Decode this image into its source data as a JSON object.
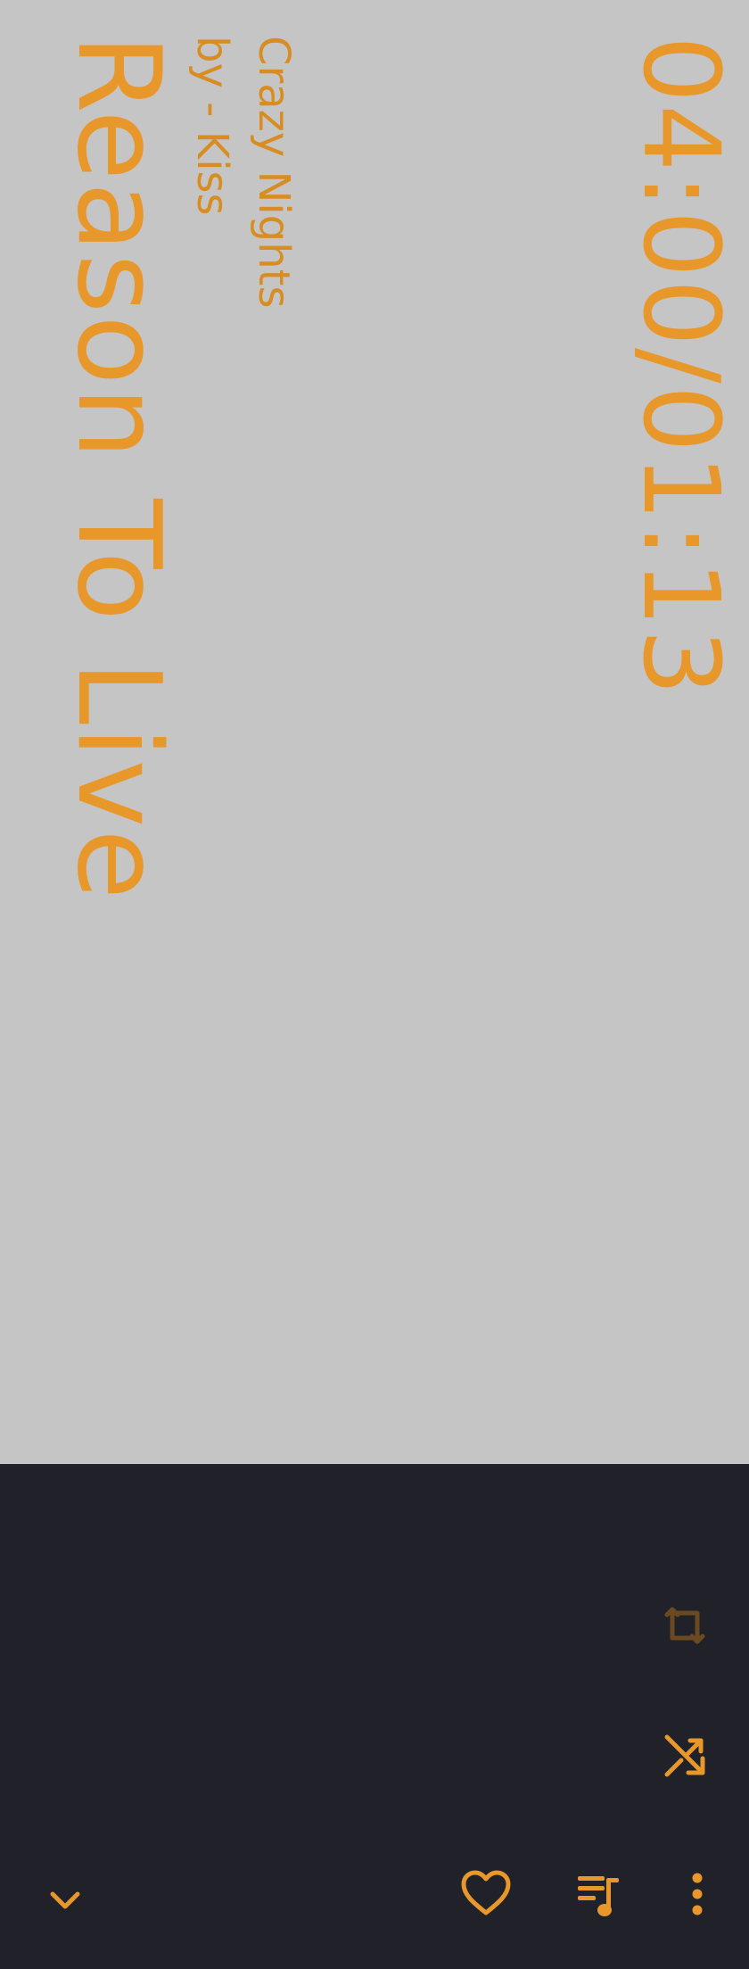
{
  "player": {
    "time_display": "04:00/01:13",
    "album": "Crazy Nights",
    "artist_line": "by - Kiss",
    "song_title": "Reason To Live"
  },
  "colors": {
    "accent": "#e8982a",
    "accent_dim": "#6b4a22",
    "art_background": "#c6c5c6",
    "panel_background": "#21212a"
  },
  "controls": {
    "repeat": "repeat-icon",
    "shuffle": "shuffle-icon",
    "collapse": "chevron-down-icon",
    "favorite": "heart-icon",
    "queue": "queue-music-icon",
    "more": "more-vert-icon"
  }
}
